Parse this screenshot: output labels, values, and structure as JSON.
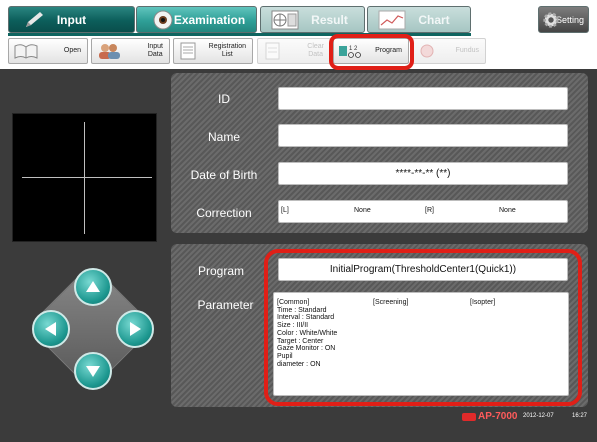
{
  "tabs": {
    "input": "Input",
    "examination": "Examination",
    "result": "Result",
    "chart": "Chart",
    "setting": "Setting"
  },
  "toolbar": {
    "open": "Open",
    "input_data": "Input\nData",
    "registration_list": "Registration\nList",
    "clear_data": "Clear\nData",
    "program": "Program",
    "fundus": "Fundus"
  },
  "patient": {
    "id_label": "ID",
    "id_value": "",
    "name_label": "Name",
    "name_value": "",
    "dob_label": "Date of Birth",
    "dob_value": "****-**-** (**)",
    "correction_label": "Correction",
    "correction_left_tag": "[L]",
    "correction_left_value": "None",
    "correction_right_tag": "[R]",
    "correction_right_value": "None"
  },
  "program": {
    "program_label": "Program",
    "program_value": "InitialProgram(ThresholdCenter1(Quick1))",
    "parameter_label": "Parameter",
    "common_header": "[Common]",
    "common_lines": [
      "Time : Standard",
      "Interval : Standard",
      "Size : III/II",
      "Color : White/White",
      "Target : Center",
      "Gaze Monitor : ON",
      "Pupil",
      "diameter : ON"
    ],
    "screening_header": "[Screening]",
    "isopter_header": "[Isopter]"
  },
  "status": {
    "model": "AP-7000",
    "date": "2012-12-07",
    "time": "16:27"
  },
  "icons": {
    "input_tab": "pencil-icon",
    "examination_tab": "eye-icon",
    "result_tab": "result-grid-icon",
    "chart_tab": "chart-icon",
    "setting_tab": "gear-icon",
    "dpad": [
      "up-arrow-icon",
      "left-arrow-icon",
      "right-arrow-icon",
      "down-arrow-icon"
    ]
  },
  "colors": {
    "accent_teal": "#0c5e5b",
    "highlight_red": "#e01f17",
    "dark_background": "#3b3b3b"
  }
}
